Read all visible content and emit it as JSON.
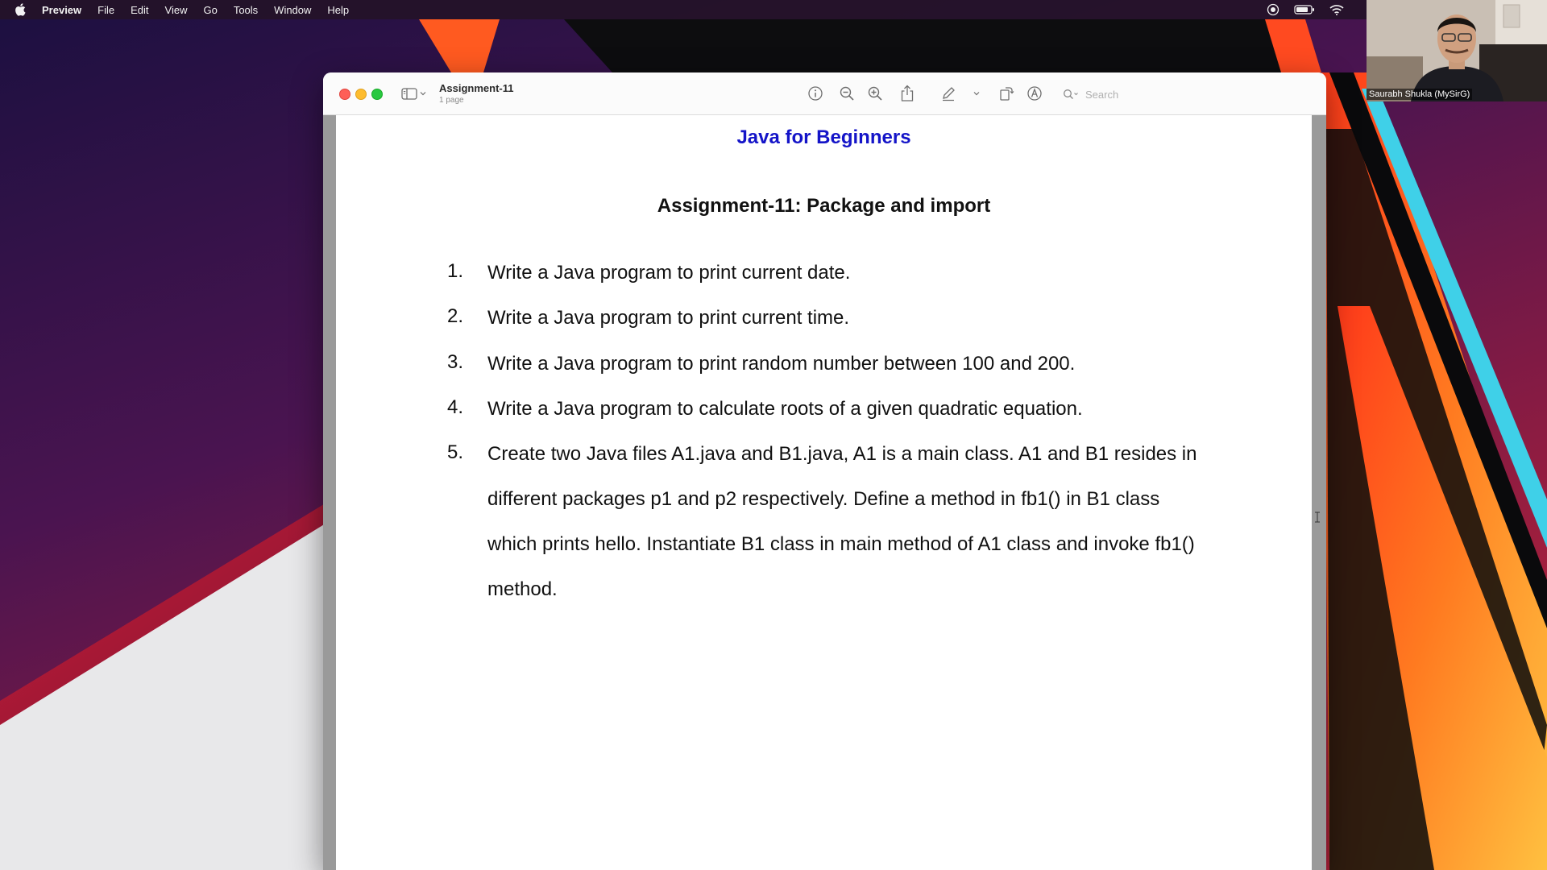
{
  "menubar": {
    "apple_icon": "apple-logo-icon",
    "app_name": "Preview",
    "items": [
      "File",
      "Edit",
      "View",
      "Go",
      "Tools",
      "Window",
      "Help"
    ],
    "status_icons": [
      "screen-record-icon",
      "battery-icon",
      "wifi-icon"
    ]
  },
  "webcam": {
    "caption": "Saurabh Shukla (MySirG)"
  },
  "window": {
    "title": "Assignment-11",
    "subtitle": "1 page",
    "search_placeholder": "Search",
    "toolbar_icons": [
      "info-icon",
      "zoom-out-icon",
      "zoom-in-icon",
      "share-icon",
      "markup-pen-icon",
      "chevron-down-icon",
      "rotate-icon",
      "annotate-icon"
    ]
  },
  "document": {
    "heading": "Java for Beginners",
    "assignment_title": "Assignment-11: Package and import",
    "tasks": [
      {
        "num": "1.",
        "lines": [
          "Write a Java program to print current date."
        ]
      },
      {
        "num": "2.",
        "lines": [
          "Write a Java program to print current time."
        ]
      },
      {
        "num": "3.",
        "lines": [
          "Write a Java program to print random number between 100 and 200."
        ]
      },
      {
        "num": "4.",
        "lines": [
          "Write a Java program to calculate roots of a given quadratic equation."
        ]
      },
      {
        "num": "5.",
        "lines": [
          "Create two Java files A1.java and B1.java, A1 is a main class. A1 and B1 resides in",
          "different packages p1 and p2 respectively. Define a method in fb1() in B1 class",
          "which prints hello. Instantiate B1 class in main method of A1 class and invoke fb1()",
          "method."
        ]
      }
    ]
  },
  "colors": {
    "heading": "#1414c8",
    "close": "#fe5f57",
    "minimize": "#febc2e",
    "maximize": "#28c840"
  }
}
